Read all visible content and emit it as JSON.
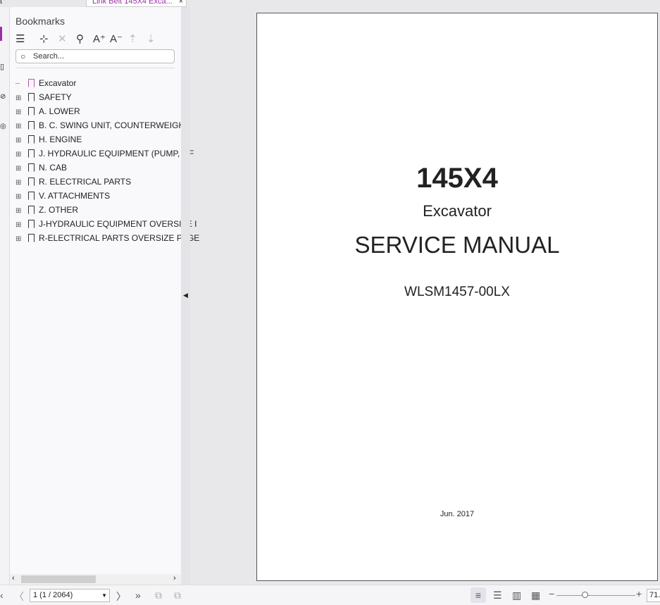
{
  "tabs": [
    {
      "label": "t"
    },
    {
      "label": "Link Belt 145X4 Exca...",
      "close": "×"
    }
  ],
  "bookmarks_panel": {
    "title": "Bookmarks",
    "search_placeholder": "Search...",
    "items": [
      {
        "label": "Excavator",
        "expandable": false
      },
      {
        "label": "SAFETY",
        "expandable": true
      },
      {
        "label": "A. LOWER",
        "expandable": true
      },
      {
        "label": "B. C. SWING UNIT, COUNTERWEIGHT",
        "expandable": true
      },
      {
        "label": "H. ENGINE",
        "expandable": true
      },
      {
        "label": "J. HYDRAULIC EQUIPMENT (PUMP, OF",
        "expandable": true
      },
      {
        "label": "N. CAB",
        "expandable": true
      },
      {
        "label": "R. ELECTRICAL PARTS",
        "expandable": true
      },
      {
        "label": "V. ATTACHMENTS",
        "expandable": true
      },
      {
        "label": "Z. OTHER",
        "expandable": true
      },
      {
        "label": "J-HYDRAULIC EQUIPMENT OVERSIZE I",
        "expandable": true
      },
      {
        "label": "R-ELECTRICAL PARTS OVERSIZE PAGE",
        "expandable": true
      }
    ]
  },
  "document": {
    "model": "145X4",
    "type": "Excavator",
    "title": "SERVICE MANUAL",
    "code": "WLSM1457-00LX",
    "date": "Jun. 2017"
  },
  "statusbar": {
    "page_value": "1 (1 / 2064)",
    "zoom_value": "71.",
    "zoom_fraction": 0.36
  }
}
